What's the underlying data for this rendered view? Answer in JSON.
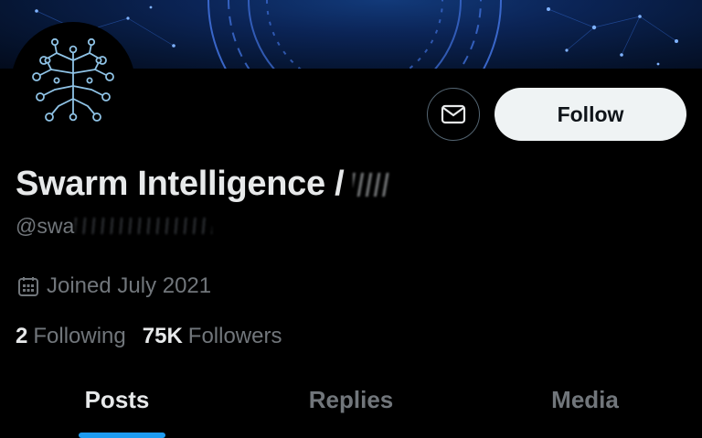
{
  "profile": {
    "display_name": "Swarm Intelligence /",
    "handle": "@swa",
    "joined": "Joined July 2021",
    "following_count": "2",
    "following_label": "Following",
    "followers_count": "75K",
    "followers_label": "Followers"
  },
  "actions": {
    "message_icon": "envelope-icon",
    "follow_label": "Follow"
  },
  "tabs": [
    {
      "label": "Posts",
      "active": true
    },
    {
      "label": "Replies",
      "active": false
    },
    {
      "label": "Media",
      "active": false
    }
  ],
  "colors": {
    "background": "#000000",
    "primary_text": "#e7e9ea",
    "secondary_text": "#71767b",
    "accent": "#1d9bf0",
    "follow_button_bg": "#eff3f4"
  }
}
